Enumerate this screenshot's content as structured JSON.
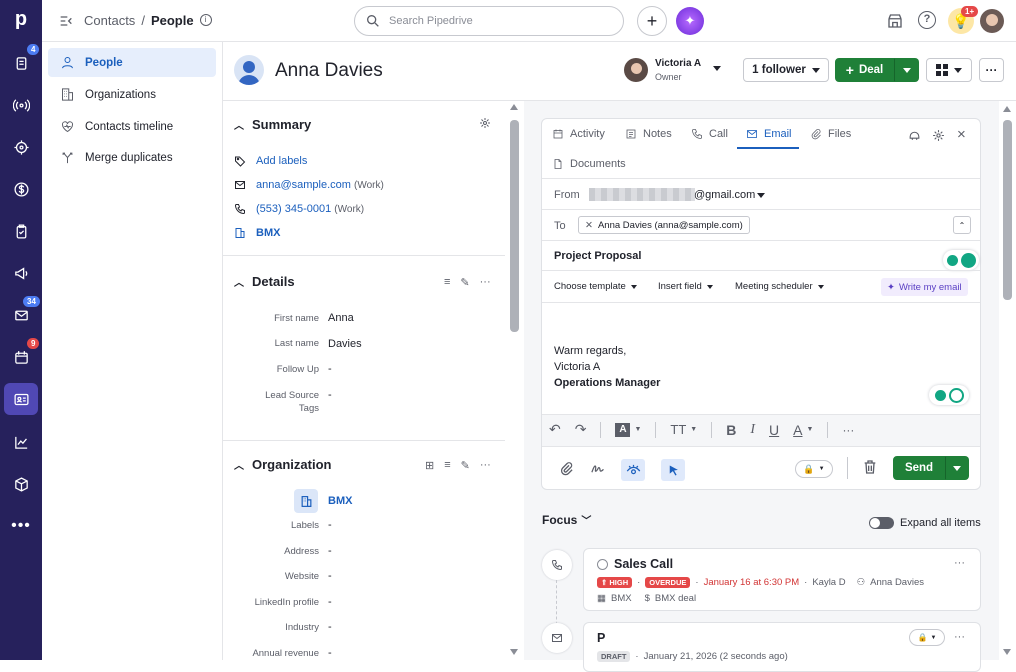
{
  "nav": {
    "badges": {
      "deals": "4",
      "mail": "34",
      "activities": "9"
    }
  },
  "topbar": {
    "breadcrumb_root": "Contacts",
    "breadcrumb_sep": "/",
    "breadcrumb_current": "People",
    "search_placeholder": "Search Pipedrive",
    "notif_badge": "1+"
  },
  "subnav": {
    "items": [
      {
        "label": "People",
        "icon": "person-icon",
        "active": true
      },
      {
        "label": "Organizations",
        "icon": "building-icon"
      },
      {
        "label": "Contacts timeline",
        "icon": "heart-icon"
      },
      {
        "label": "Merge duplicates",
        "icon": "merge-icon"
      }
    ]
  },
  "person": {
    "name": "Anna Davies",
    "owner_name": "Victoria A",
    "owner_role": "Owner",
    "follower_label": "1 follower",
    "deal_label": "Deal"
  },
  "summary": {
    "title": "Summary",
    "add_labels": "Add labels",
    "email": "anna@sample.com",
    "email_type": "(Work)",
    "phone": "(553) 345-0001",
    "phone_type": "(Work)",
    "org": "BMX"
  },
  "details": {
    "title": "Details",
    "fields": [
      {
        "label": "First name",
        "value": "Anna"
      },
      {
        "label": "Last name",
        "value": "Davies"
      },
      {
        "label": "Follow Up",
        "value": "-"
      },
      {
        "label": "Lead Source",
        "value": "-"
      },
      {
        "label": "Tags",
        "value": ""
      }
    ]
  },
  "organization": {
    "title": "Organization",
    "name": "BMX",
    "fields": [
      {
        "label": "Labels",
        "value": "-"
      },
      {
        "label": "Address",
        "value": "-"
      },
      {
        "label": "Website",
        "value": "-"
      },
      {
        "label": "LinkedIn profile",
        "value": "-"
      },
      {
        "label": "Industry",
        "value": "-"
      },
      {
        "label": "Annual revenue",
        "value": "-"
      }
    ]
  },
  "composer": {
    "tabs": [
      "Activity",
      "Notes",
      "Call",
      "Email",
      "Files",
      "Documents"
    ],
    "active_tab": "Email",
    "from_label": "From",
    "from_value": "@gmail.com",
    "to_label": "To",
    "to_value": "Anna Davies (anna@sample.com)",
    "subject": "Project Proposal",
    "toolbar": {
      "template": "Choose template",
      "insert": "Insert field",
      "meeting": "Meeting scheduler",
      "ai": "Write my email"
    },
    "body": {
      "line1": "Warm regards,",
      "line2": "Victoria A",
      "line3": "Operations Manager"
    },
    "send": "Send"
  },
  "focus": {
    "title": "Focus",
    "expand": "Expand all items",
    "item1": {
      "title": "Sales Call",
      "priority": "HIGH",
      "status": "OVERDUE",
      "when": "January 16 at 6:30 PM",
      "sep": "·",
      "assignee": "Kayla D",
      "person": "Anna Davies",
      "org": "BMX",
      "deal": "BMX deal"
    },
    "item2": {
      "title": "P",
      "status": "DRAFT",
      "when": "January 21, 2026 (2 seconds ago)"
    }
  },
  "colors": {
    "rail": "#26215c",
    "accent": "#1b5fbd",
    "green": "#1f8038",
    "red": "#e54848"
  }
}
